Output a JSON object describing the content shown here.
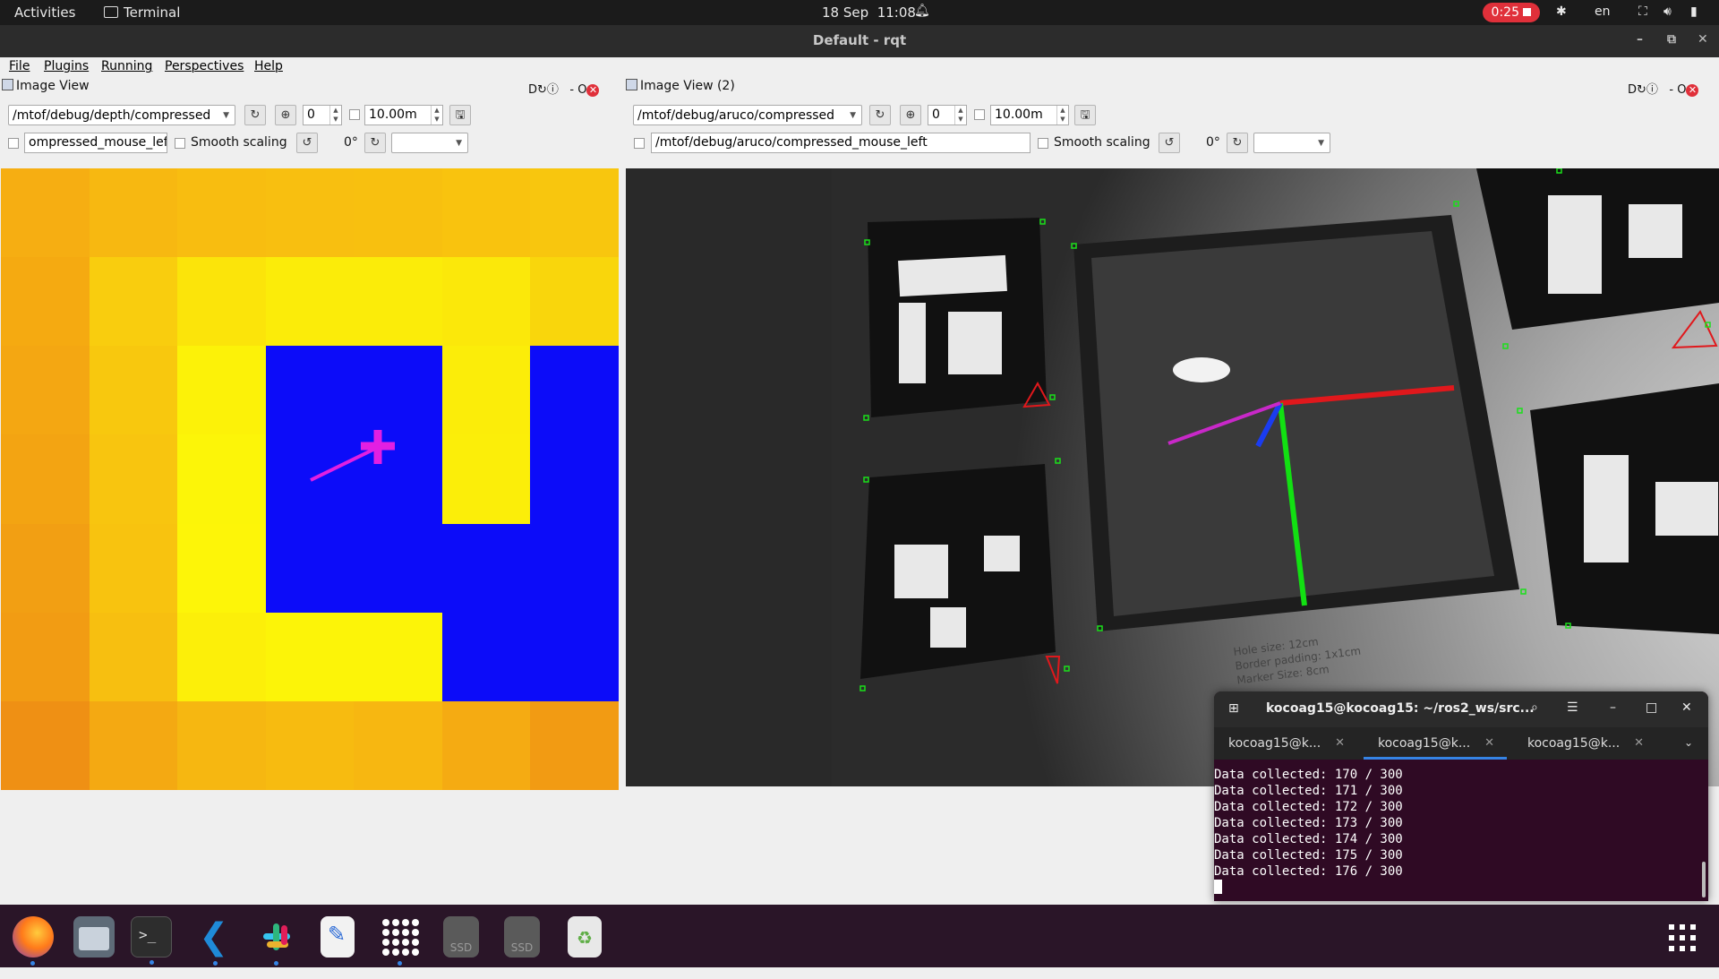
{
  "topbar": {
    "activities": "Activities",
    "app": "Terminal",
    "date": "18 Sep",
    "time": "11:08",
    "recording": "0:25",
    "lang": "en"
  },
  "window": {
    "title": "Default - rqt"
  },
  "menu": [
    "File",
    "Plugins",
    "Running",
    "Perspectives",
    "Help"
  ],
  "panels": [
    {
      "title": "Image View",
      "topic": "/mtof/debug/depth/compressed",
      "zoom_value": "0",
      "max_range": "10.00m",
      "mouse_topic": "ompressed_mouse_left",
      "smooth_label": "Smooth scaling",
      "rotation": "0°",
      "dock_label": "D"
    },
    {
      "title": "Image View (2)",
      "topic": "/mtof/debug/aruco/compressed",
      "zoom_value": "0",
      "max_range": "10.00m",
      "mouse_topic": "/mtof/debug/aruco/compressed_mouse_left",
      "smooth_label": "Smooth scaling",
      "rotation": "0°",
      "dock_label": "D"
    }
  ],
  "depth_grid": [
    [
      "#f6ae12",
      "#f7b811",
      "#f8bd10",
      "#f8bf10",
      "#f8c00f",
      "#f9c30e",
      "#f8c60e"
    ],
    [
      "#f5aa11",
      "#f9cd0e",
      "#fbe40a",
      "#fbec09",
      "#fbec09",
      "#fbe80a",
      "#f9d60c"
    ],
    [
      "#f4a712",
      "#f8c80e",
      "#fcf208",
      "#0c0cf9",
      "#0c0cf9",
      "#fbed09",
      "#0c0cf9"
    ],
    [
      "#f3a412",
      "#f8c50f",
      "#fcf508",
      "#0c0cf9",
      "#0c0cf9",
      "#fbee09",
      "#0c0cf9"
    ],
    [
      "#f29f13",
      "#f8c30f",
      "#fdf508",
      "#0c0cf9",
      "#0c0cf9",
      "#0c0cf9",
      "#0c0cf9"
    ],
    [
      "#f29c13",
      "#f7bf10",
      "#fcef09",
      "#fcf408",
      "#fcf408",
      "#0c0cf9",
      "#0c0cf9"
    ],
    [
      "#ef9014",
      "#f4a912",
      "#f6b711",
      "#f7bb10",
      "#f7b711",
      "#f5ab12",
      "#f29b13"
    ]
  ],
  "terminal": {
    "title": "kocoag15@kocoag15: ~/ros2_ws/src...",
    "tabs": [
      "kocoag15@k...",
      "kocoag15@k...",
      "kocoag15@k..."
    ],
    "lines": [
      "Data collected: 170 / 300",
      "Data collected: 171 / 300",
      "Data collected: 172 / 300",
      "Data collected: 173 / 300",
      "Data collected: 174 / 300",
      "Data collected: 175 / 300",
      "Data collected: 176 / 300"
    ]
  },
  "aruco_text": [
    "Hole size: 12cm",
    "Border padding: 1x1cm",
    "Marker Size: 8cm"
  ],
  "dock": [
    {
      "name": "firefox-icon",
      "label": "Firefox",
      "color": "#e66000"
    },
    {
      "name": "files-icon",
      "label": "Files",
      "color": "#5e6b78"
    },
    {
      "name": "terminal-icon",
      "label": "Terminal",
      "color": "#2d2d2d"
    },
    {
      "name": "vscode-icon",
      "label": "VS Code",
      "color": "#1f7fd1"
    },
    {
      "name": "slack-icon",
      "label": "Slack",
      "color": "#ffffff"
    },
    {
      "name": "text-editor-icon",
      "label": "Text Editor",
      "color": "#f2f2f2"
    },
    {
      "name": "show-apps-grid-icon",
      "label": "",
      "color": "#1b1b1b"
    },
    {
      "name": "ssd-drive-icon",
      "label": "SSD",
      "color": "#5a5a5a"
    },
    {
      "name": "ssd-drive-icon-2",
      "label": "SSD",
      "color": "#5a5a5a"
    },
    {
      "name": "trash-icon",
      "label": "",
      "color": "#e8e8e8"
    }
  ]
}
